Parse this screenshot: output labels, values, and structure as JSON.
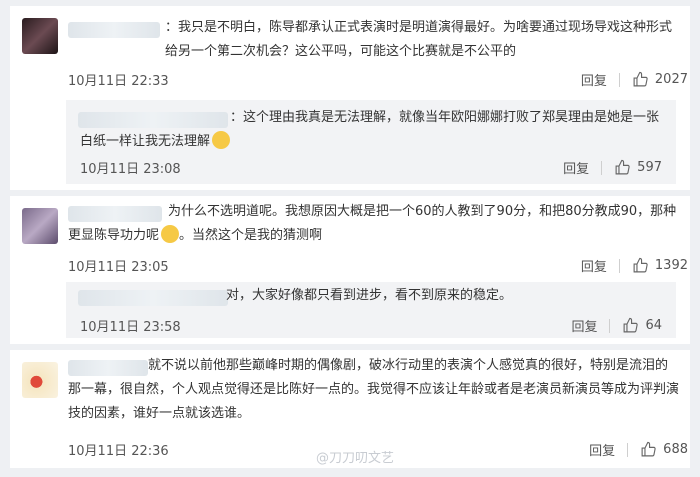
{
  "comments": [
    {
      "text": "：我只是不明白，陈导都承认正式表演时是明道演得最好。为啥要通过现场导戏这种形式给另一个第二次机会？这公平吗，可能这个比赛就是不公平的",
      "time": "10月11日 22:33",
      "reply_label": "回复",
      "likes": "2027",
      "sub": {
        "text": "：这个理由我真是无法理解，就像当年欧阳娜娜打败了郑昊理由是她是一张白纸一样让我无法理解",
        "time": "10月11日 23:08",
        "reply_label": "回复",
        "likes": "597"
      }
    },
    {
      "text": "为什么不选明道呢。我想原因大概是把一个60的人教到了90分，和把80分教成90，那种更显陈导功力呢",
      "text_tail": "。当然这个是我的猜测啊",
      "time": "10月11日 23:05",
      "reply_label": "回复",
      "likes": "1392",
      "sub": {
        "text": "对，大家好像都只看到进步，看不到原来的稳定。",
        "time": "10月11日 23:58",
        "reply_label": "回复",
        "likes": "64"
      }
    },
    {
      "text": "就不说以前他那些巅峰时期的偶像剧，破冰行动里的表演个人感觉真的很好，特别是流泪的那一幕，很自然，个人观点觉得还是比陈好一点的。我觉得不应该让年龄或者是老演员新演员等成为评判演技的因素，谁好一点就该选谁。",
      "time": "10月11日 22:36",
      "reply_label": "回复",
      "likes": "688"
    }
  ],
  "watermark": "@刀刀叨文艺",
  "colors": {
    "background": "#eef0f3",
    "sub_background": "#f2f3f5",
    "text": "#333333"
  }
}
